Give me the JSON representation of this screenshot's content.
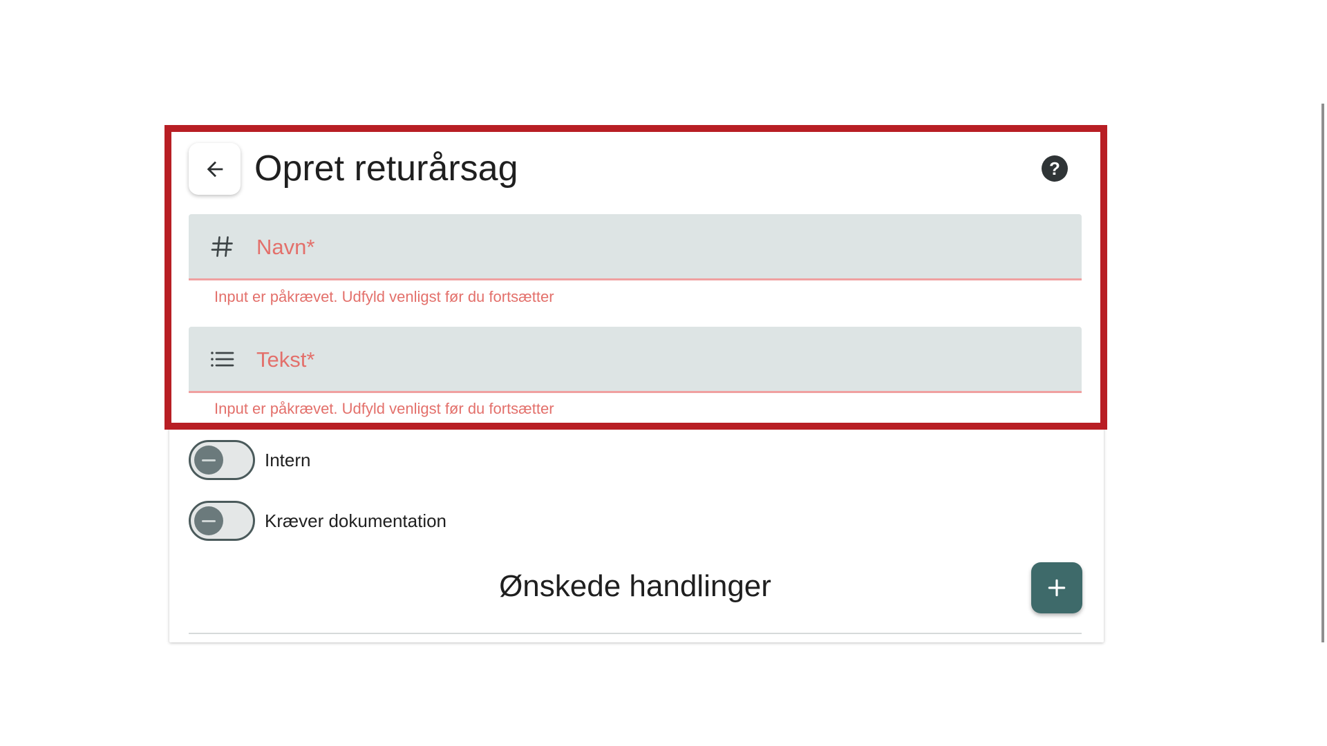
{
  "header": {
    "title": "Opret returårsag",
    "back_icon": "arrow-left-icon",
    "help_label": "?"
  },
  "form": {
    "name_field": {
      "icon": "hash-icon",
      "label": "Navn*",
      "value": "",
      "error": "Input er påkrævet. Udfyld venligst før du fortsætter"
    },
    "text_field": {
      "icon": "list-icon",
      "label": "Tekst*",
      "value": "",
      "error": "Input er påkrævet. Udfyld venligst før du fortsætter"
    },
    "toggles": [
      {
        "label": "Intern",
        "checked": false
      },
      {
        "label": "Kræver dokumentation",
        "checked": false
      }
    ]
  },
  "actions_section": {
    "title": "Ønskede handlinger",
    "add_icon": "plus-icon"
  },
  "colors": {
    "accent": "#3e6a6a",
    "error": "#e3706b",
    "field_bg": "#dde4e4",
    "highlight": "#b81e24"
  }
}
